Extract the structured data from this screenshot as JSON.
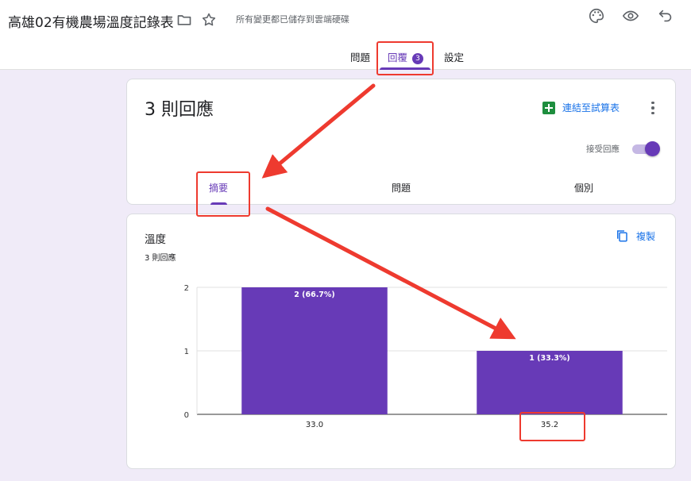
{
  "header": {
    "title": "高雄02有機農場溫度記錄表",
    "save_status": "所有變更都已儲存到雲端硬碟",
    "icons": [
      "folder-icon",
      "star-icon",
      "palette-icon",
      "eye-icon",
      "undo-icon"
    ]
  },
  "tabs": [
    {
      "label": "問題",
      "active": false
    },
    {
      "label": "回覆",
      "active": true,
      "badge": "3"
    },
    {
      "label": "設定",
      "active": false
    }
  ],
  "responses": {
    "count_label": "3 則回應",
    "link_sheet_label": "連結至試算表",
    "accept_label": "接受回應",
    "accepting": true,
    "subtabs": [
      {
        "label": "摘要",
        "active": true
      },
      {
        "label": "問題",
        "active": false
      },
      {
        "label": "個別",
        "active": false
      }
    ]
  },
  "question": {
    "title": "溫度",
    "response_count": "3 則回應",
    "copy_label": "複製"
  },
  "chart_data": {
    "type": "bar",
    "categories": [
      "33.0",
      "35.2"
    ],
    "values": [
      2,
      1
    ],
    "data_labels": [
      "2 (66.7%)",
      "1 (33.3%)"
    ],
    "y_ticks": [
      "0",
      "1",
      "2"
    ],
    "ylim": [
      0,
      2
    ],
    "grid": true,
    "bar_color": "#673ab7"
  },
  "colors": {
    "accent": "#673ab7",
    "link": "#1a73e8",
    "annotation": "#ee3a2f",
    "background": "#f0ebf8"
  }
}
